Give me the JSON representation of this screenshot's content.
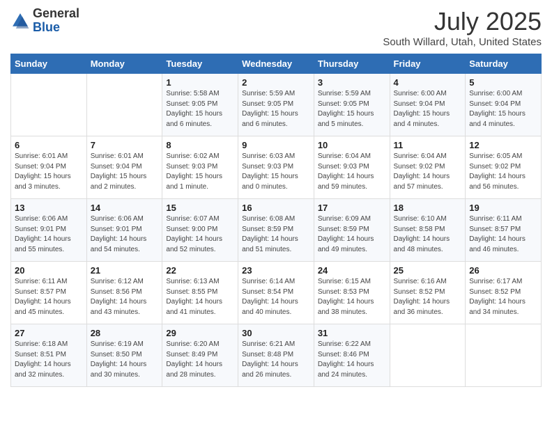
{
  "logo": {
    "general": "General",
    "blue": "Blue"
  },
  "title": "July 2025",
  "subtitle": "South Willard, Utah, United States",
  "weekdays": [
    "Sunday",
    "Monday",
    "Tuesday",
    "Wednesday",
    "Thursday",
    "Friday",
    "Saturday"
  ],
  "weeks": [
    [
      {
        "day": "",
        "info": ""
      },
      {
        "day": "",
        "info": ""
      },
      {
        "day": "1",
        "info": "Sunrise: 5:58 AM\nSunset: 9:05 PM\nDaylight: 15 hours and 6 minutes."
      },
      {
        "day": "2",
        "info": "Sunrise: 5:59 AM\nSunset: 9:05 PM\nDaylight: 15 hours and 6 minutes."
      },
      {
        "day": "3",
        "info": "Sunrise: 5:59 AM\nSunset: 9:05 PM\nDaylight: 15 hours and 5 minutes."
      },
      {
        "day": "4",
        "info": "Sunrise: 6:00 AM\nSunset: 9:04 PM\nDaylight: 15 hours and 4 minutes."
      },
      {
        "day": "5",
        "info": "Sunrise: 6:00 AM\nSunset: 9:04 PM\nDaylight: 15 hours and 4 minutes."
      }
    ],
    [
      {
        "day": "6",
        "info": "Sunrise: 6:01 AM\nSunset: 9:04 PM\nDaylight: 15 hours and 3 minutes."
      },
      {
        "day": "7",
        "info": "Sunrise: 6:01 AM\nSunset: 9:04 PM\nDaylight: 15 hours and 2 minutes."
      },
      {
        "day": "8",
        "info": "Sunrise: 6:02 AM\nSunset: 9:03 PM\nDaylight: 15 hours and 1 minute."
      },
      {
        "day": "9",
        "info": "Sunrise: 6:03 AM\nSunset: 9:03 PM\nDaylight: 15 hours and 0 minutes."
      },
      {
        "day": "10",
        "info": "Sunrise: 6:04 AM\nSunset: 9:03 PM\nDaylight: 14 hours and 59 minutes."
      },
      {
        "day": "11",
        "info": "Sunrise: 6:04 AM\nSunset: 9:02 PM\nDaylight: 14 hours and 57 minutes."
      },
      {
        "day": "12",
        "info": "Sunrise: 6:05 AM\nSunset: 9:02 PM\nDaylight: 14 hours and 56 minutes."
      }
    ],
    [
      {
        "day": "13",
        "info": "Sunrise: 6:06 AM\nSunset: 9:01 PM\nDaylight: 14 hours and 55 minutes."
      },
      {
        "day": "14",
        "info": "Sunrise: 6:06 AM\nSunset: 9:01 PM\nDaylight: 14 hours and 54 minutes."
      },
      {
        "day": "15",
        "info": "Sunrise: 6:07 AM\nSunset: 9:00 PM\nDaylight: 14 hours and 52 minutes."
      },
      {
        "day": "16",
        "info": "Sunrise: 6:08 AM\nSunset: 8:59 PM\nDaylight: 14 hours and 51 minutes."
      },
      {
        "day": "17",
        "info": "Sunrise: 6:09 AM\nSunset: 8:59 PM\nDaylight: 14 hours and 49 minutes."
      },
      {
        "day": "18",
        "info": "Sunrise: 6:10 AM\nSunset: 8:58 PM\nDaylight: 14 hours and 48 minutes."
      },
      {
        "day": "19",
        "info": "Sunrise: 6:11 AM\nSunset: 8:57 PM\nDaylight: 14 hours and 46 minutes."
      }
    ],
    [
      {
        "day": "20",
        "info": "Sunrise: 6:11 AM\nSunset: 8:57 PM\nDaylight: 14 hours and 45 minutes."
      },
      {
        "day": "21",
        "info": "Sunrise: 6:12 AM\nSunset: 8:56 PM\nDaylight: 14 hours and 43 minutes."
      },
      {
        "day": "22",
        "info": "Sunrise: 6:13 AM\nSunset: 8:55 PM\nDaylight: 14 hours and 41 minutes."
      },
      {
        "day": "23",
        "info": "Sunrise: 6:14 AM\nSunset: 8:54 PM\nDaylight: 14 hours and 40 minutes."
      },
      {
        "day": "24",
        "info": "Sunrise: 6:15 AM\nSunset: 8:53 PM\nDaylight: 14 hours and 38 minutes."
      },
      {
        "day": "25",
        "info": "Sunrise: 6:16 AM\nSunset: 8:52 PM\nDaylight: 14 hours and 36 minutes."
      },
      {
        "day": "26",
        "info": "Sunrise: 6:17 AM\nSunset: 8:52 PM\nDaylight: 14 hours and 34 minutes."
      }
    ],
    [
      {
        "day": "27",
        "info": "Sunrise: 6:18 AM\nSunset: 8:51 PM\nDaylight: 14 hours and 32 minutes."
      },
      {
        "day": "28",
        "info": "Sunrise: 6:19 AM\nSunset: 8:50 PM\nDaylight: 14 hours and 30 minutes."
      },
      {
        "day": "29",
        "info": "Sunrise: 6:20 AM\nSunset: 8:49 PM\nDaylight: 14 hours and 28 minutes."
      },
      {
        "day": "30",
        "info": "Sunrise: 6:21 AM\nSunset: 8:48 PM\nDaylight: 14 hours and 26 minutes."
      },
      {
        "day": "31",
        "info": "Sunrise: 6:22 AM\nSunset: 8:46 PM\nDaylight: 14 hours and 24 minutes."
      },
      {
        "day": "",
        "info": ""
      },
      {
        "day": "",
        "info": ""
      }
    ]
  ]
}
